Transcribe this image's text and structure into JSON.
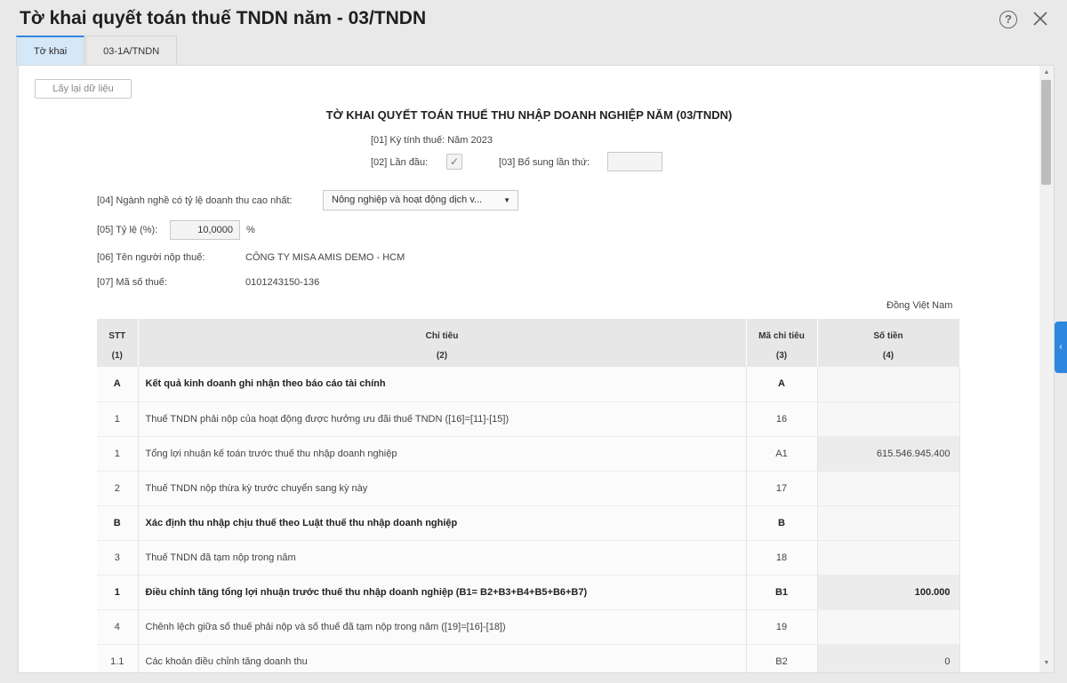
{
  "window": {
    "title": "Tờ khai quyết toán thuế TNDN năm - 03/TNDN",
    "help_icon": "?"
  },
  "tabs": [
    {
      "label": "Tờ khai",
      "active": true
    },
    {
      "label": "03-1A/TNDN",
      "active": false
    }
  ],
  "toolbar": {
    "reload_label": "Lấy lại dữ liệu"
  },
  "form": {
    "title": "TỜ KHAI QUYẾT TOÁN THUẾ THU NHẬP DOANH NGHIỆP NĂM (03/TNDN)",
    "period": "[01] Kỳ tính thuế: Năm 2023",
    "first_time_label": "[02] Lần đầu:",
    "first_time_checked": true,
    "supplement_label": "[03] Bổ sung lần thứ:",
    "supplement_value": "",
    "industry_label": "[04] Ngành nghề có tỷ lệ doanh thu cao nhất:",
    "industry_value": "Nông nghiệp và hoạt động dịch v...",
    "rate_label": "[05] Tỷ lệ (%):",
    "rate_value": "10,0000",
    "rate_unit": "%",
    "taxpayer_label": "[06] Tên người nộp thuế:",
    "taxpayer_value": "CÔNG TY MISA AMIS DEMO - HCM",
    "taxcode_label": "[07] Mã số thuế:",
    "taxcode_value": "0101243150-136",
    "currency_note": "Đồng Việt Nam"
  },
  "table": {
    "headers": [
      {
        "label": "STT",
        "num": "(1)"
      },
      {
        "label": "Chỉ tiêu",
        "num": "(2)"
      },
      {
        "label": "Mã chỉ tiêu",
        "num": "(3)"
      },
      {
        "label": "Số tiền",
        "num": "(4)"
      }
    ],
    "rows": [
      {
        "stt": "A",
        "name": "Kết quả kinh doanh ghi nhận theo báo cáo tài chính",
        "code": "A",
        "amount": "",
        "bold": true
      },
      {
        "stt": "1",
        "name": "Thuế TNDN phải nộp của hoạt động được hưởng ưu đãi thuế TNDN ([16]=[11]-[15])",
        "code": "16",
        "amount": "",
        "bold": false
      },
      {
        "stt": "1",
        "name": "Tổng lợi nhuận kế toán trước thuế thu nhập doanh nghiệp",
        "code": "A1",
        "amount": "615.546.945.400",
        "bold": false
      },
      {
        "stt": "2",
        "name": "Thuế TNDN nộp thừa kỳ trước chuyển sang kỳ này",
        "code": "17",
        "amount": "",
        "bold": false
      },
      {
        "stt": "B",
        "name": "Xác định thu nhập chịu thuế theo Luật thuế thu nhập doanh nghiệp",
        "code": "B",
        "amount": "",
        "bold": true
      },
      {
        "stt": "3",
        "name": "Thuế TNDN đã tạm nộp trong năm",
        "code": "18",
        "amount": "",
        "bold": false
      },
      {
        "stt": "1",
        "name": "Điều chỉnh tăng tổng lợi nhuận trước thuế thu nhập doanh nghiệp (B1= B2+B3+B4+B5+B6+B7)",
        "code": "B1",
        "amount": "100.000",
        "bold": true
      },
      {
        "stt": "4",
        "name": "Chênh lệch giữa số thuế phải nộp và số thuế đã tạm nộp trong năm ([19]=[16]-[18])",
        "code": "19",
        "amount": "",
        "bold": false
      },
      {
        "stt": "1.1",
        "name": "Các khoản điều chỉnh tăng doanh thu",
        "code": "B2",
        "amount": "0",
        "bold": false
      }
    ]
  },
  "side_handle_glyph": "‹"
}
